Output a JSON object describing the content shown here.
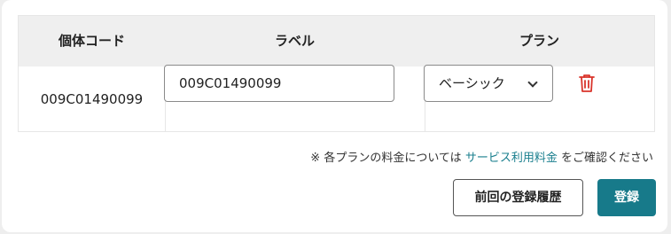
{
  "table": {
    "headers": [
      "個体コード",
      "ラベル",
      "プラン"
    ],
    "rows": [
      {
        "id": "009C01490099",
        "label_value": "009C01490099",
        "plan": "ベーシック"
      }
    ]
  },
  "note": {
    "prefix": "※ 各プランの料金については",
    "link": "サービス利用料金",
    "suffix": "をご確認ください"
  },
  "buttons": {
    "history": "前回の登録履歴",
    "register": "登録"
  },
  "colors": {
    "accent": "#177a8a",
    "link": "#1a7f8e",
    "delete": "#d9342b",
    "header_bg": "#efefef"
  },
  "icons": {
    "delete": "trash-icon",
    "dropdown": "chevron-down-icon"
  }
}
